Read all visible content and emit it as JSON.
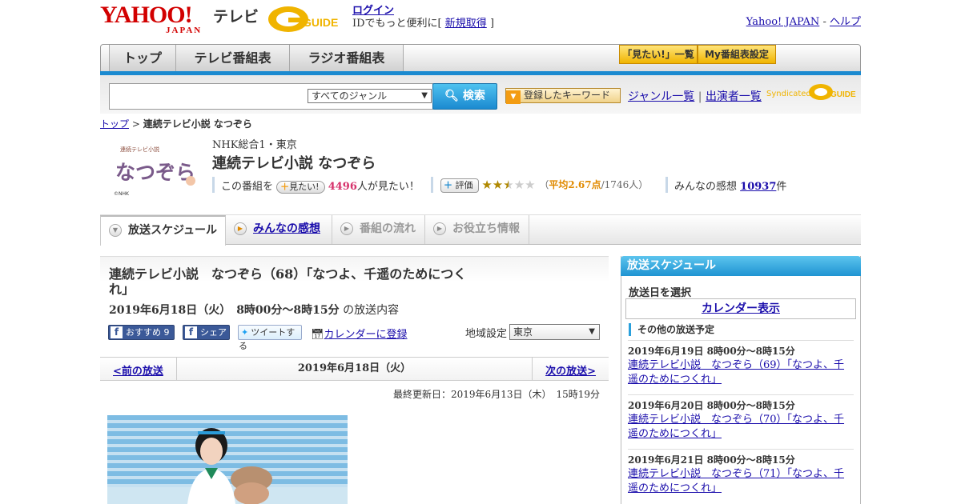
{
  "header": {
    "yahoo_logo": "YAHOO!",
    "yahoo_sub": "JAPAN",
    "tv_label": "テレビ",
    "gguide_logo": "GUIDE",
    "login_label": "ログイン",
    "id_text_prefix": "IDでもっと便利に[",
    "register_label": "新規取得",
    "id_text_suffix": "]",
    "yahoo_japan_link": "Yahoo! JAPAN",
    "link_separator": "-",
    "help_link": "ヘルプ"
  },
  "nav": {
    "tabs": [
      "トップ",
      "テレビ番組表",
      "ラジオ番組表"
    ],
    "mitai_list": "「見たい!」一覧",
    "my_schedule": "My番組表設定"
  },
  "search": {
    "placeholder": "",
    "genre_value": "すべてのジャンル",
    "button": "検索",
    "keyword_button": "登録したキーワード",
    "genre_list": "ジャンル一覧",
    "link_divider": "|",
    "cast_list": "出演者一覧",
    "syndicated": "Syndicated",
    "syndicated_logo": "GUIDE"
  },
  "breadcrumb": {
    "top": "トップ",
    "separator": ">",
    "current": "連続テレビ小説 なつぞら"
  },
  "program": {
    "image_text": "なつぞら",
    "image_caption": "連続テレビ小説",
    "image_credit": "©NHK",
    "channel": "NHK総合1・東京",
    "title": "連続テレビ小説 なつぞら",
    "want_prefix": "この番組を",
    "want_button": "見たい!",
    "want_count": "4496",
    "want_suffix": "人が見たい！",
    "hyoka_button": "評価",
    "rating_open": "（",
    "rating_label": "平均2.67点",
    "rating_count": "/1746人）",
    "rating_value": 2.67,
    "kansou_label": "みんなの感想",
    "kansou_count": "10937",
    "kansou_suffix": "件"
  },
  "tabs": [
    {
      "label": "放送スケジュール"
    },
    {
      "label": "みんなの感想"
    },
    {
      "label": "番組の流れ"
    },
    {
      "label": "お役立ち情報"
    }
  ],
  "episode": {
    "title": "連続テレビ小説　なつぞら（68）「なつよ、千遥のためにつくれ」",
    "time": "2019年6月18日（火）　8時00分～8時15分",
    "time_suffix": "の放送内容",
    "osusume": "おすすめ 9",
    "share": "シェア",
    "tweet": "ツイートする",
    "calendar_reg": "カレンダーに登録",
    "region_label": "地域設定",
    "region_value": "東京"
  },
  "pager": {
    "prev": "<前の放送",
    "date": "2019年6月18日（火）",
    "next": "次の放送>"
  },
  "updated": "最終更新日：2019年6月13日（木）　15時19分",
  "sidebar": {
    "title": "放送スケジュール",
    "select_date": "放送日を選択",
    "calendar": "カレンダー表示",
    "other_head": "その他の放送予定",
    "items": [
      {
        "time": "2019年6月19日  8時00分～8時15分",
        "title": "連続テレビ小説　なつぞら（69）「なつよ、千遥のためにつくれ」"
      },
      {
        "time": "2019年6月20日  8時00分～8時15分",
        "title": "連続テレビ小説　なつぞら（70）「なつよ、千遥のためにつくれ」"
      },
      {
        "time": "2019年6月21日  8時00分～8時15分",
        "title": "連続テレビ小説　なつぞら（71）「なつよ、千遥のためにつくれ」"
      }
    ]
  },
  "colors": {
    "accent_blue": "#1b8ad0",
    "yahoo_red": "#d20000",
    "link": "#1a0dab",
    "gold": "#f0b400"
  }
}
